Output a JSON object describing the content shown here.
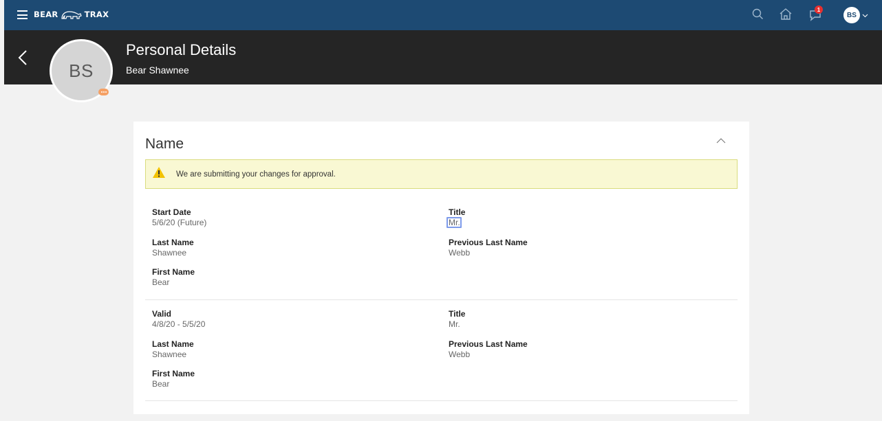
{
  "topbar": {
    "brand_left": "BEAR",
    "brand_right": "TRAX",
    "notification_count": "1",
    "user_initials": "BS"
  },
  "header": {
    "title": "Personal Details",
    "subtitle": "Bear Shawnee",
    "avatar_initials": "BS"
  },
  "card": {
    "title": "Name",
    "alert": "We are submitting your changes for approval."
  },
  "records": [
    {
      "start_label": "Start Date",
      "start_value": "5/6/20 (Future)",
      "title_label": "Title",
      "title_value": "Mr.",
      "last_label": "Last Name",
      "last_value": "Shawnee",
      "prev_label": "Previous Last Name",
      "prev_value": "Webb",
      "first_label": "First Name",
      "first_value": "Bear"
    },
    {
      "start_label": "Valid",
      "start_value": "4/8/20 - 5/5/20",
      "title_label": "Title",
      "title_value": "Mr.",
      "last_label": "Last Name",
      "last_value": "Shawnee",
      "prev_label": "Previous Last Name",
      "prev_value": "Webb",
      "first_label": "First Name",
      "first_value": "Bear"
    }
  ],
  "colors": {
    "nav": "#1d4a73",
    "header": "#252525",
    "alert_bg": "#f9f8d3",
    "warning": "#f2c200",
    "badge": "#e8302f"
  }
}
